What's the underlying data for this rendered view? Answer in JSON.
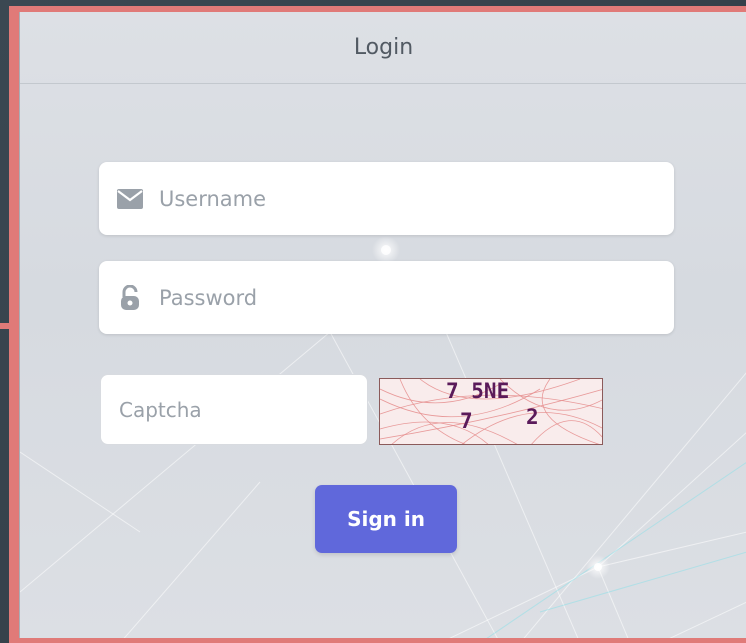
{
  "header": {
    "title": "Login"
  },
  "form": {
    "username": {
      "icon": "envelope-icon",
      "placeholder": "Username",
      "value": ""
    },
    "password": {
      "icon": "unlock-icon",
      "placeholder": "Password",
      "value": ""
    },
    "captcha": {
      "placeholder": "Captcha",
      "value": "",
      "image_text_line1": "7 5NE",
      "image_text_line2a": "7",
      "image_text_line2b": "2"
    },
    "submit_label": "Sign in"
  },
  "colors": {
    "accent": "#6068db",
    "frame": "#e07a78",
    "header_text": "#525a63",
    "placeholder_text": "#9aa1a9"
  }
}
